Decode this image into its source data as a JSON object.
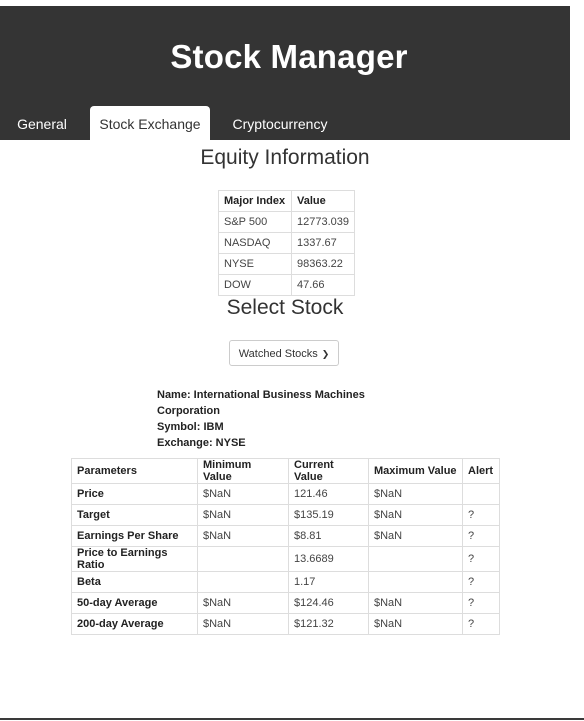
{
  "app": {
    "title": "Stock Manager"
  },
  "tabs": [
    {
      "label": "General",
      "active": false
    },
    {
      "label": "Stock Exchange",
      "active": true
    },
    {
      "label": "Cryptocurrency",
      "active": false
    }
  ],
  "equity": {
    "title": "Equity Information",
    "headers": [
      "Major Index",
      "Value"
    ],
    "rows": [
      [
        "S&P 500",
        "12773.039"
      ],
      [
        "NASDAQ",
        "1337.67"
      ],
      [
        "NYSE",
        "98363.22"
      ],
      [
        "DOW",
        "47.66"
      ]
    ]
  },
  "select_stock": {
    "title": "Select Stock",
    "dropdown_label": "Watched Stocks"
  },
  "stock_info": {
    "name_line1": "Name: International Business Machines",
    "name_line2": "Corporation",
    "symbol": "Symbol: IBM",
    "exchange": "Exchange: NYSE"
  },
  "parameters": {
    "headers": [
      "Parameters",
      "Minimum Value",
      "Current Value",
      "Maximum Value",
      "Alert"
    ],
    "rows": [
      [
        "Price",
        "$NaN",
        "121.46",
        "$NaN",
        ""
      ],
      [
        "Target",
        "$NaN",
        "$135.19",
        "$NaN",
        "?"
      ],
      [
        "Earnings Per Share",
        "$NaN",
        "$8.81",
        "$NaN",
        "?"
      ],
      [
        "Price to Earnings Ratio",
        "",
        "13.6689",
        "",
        "?"
      ],
      [
        "Beta",
        "",
        "1.17",
        "",
        "?"
      ],
      [
        "50-day Average",
        "$NaN",
        "$124.46",
        "$NaN",
        "?"
      ],
      [
        "200-day Average",
        "$NaN",
        "$121.32",
        "$NaN",
        "?"
      ]
    ]
  }
}
